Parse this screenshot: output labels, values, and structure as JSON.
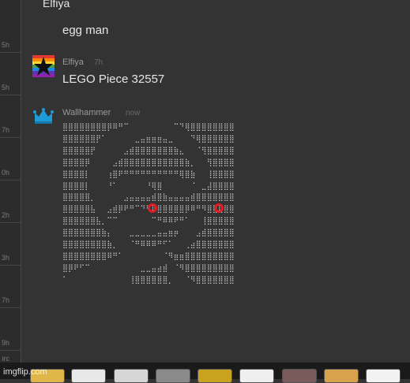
{
  "left_column": {
    "times": [
      "5h",
      "5h",
      "7h",
      "0h",
      "2h",
      "3h",
      "7h",
      "9h"
    ],
    "last_partial": "irc"
  },
  "messages": [
    {
      "name": "Elfiya",
      "text": "egg man"
    },
    {
      "name": "Elfiya",
      "time": "7h",
      "text": "LEGO Piece 32557",
      "avatar_icon": "rainbow-star-icon"
    },
    {
      "name": "Wallhammer",
      "time": "now",
      "avatar_icon": "crown-icon"
    }
  ],
  "ascii_art": [
    "⣿⣿⣿⣿⣿⣿⣿⣿⡿⠿⠛⠉⠀⠀⠀⠀⠀⠀⠀⠀⠉⠙⢿⣿⣿⣿⣿⣿⣿⣿⣿",
    "⣿⣿⣿⣿⣿⣿⡟⠁⠀⠀⠀⠀⠀⣀⣤⣶⣶⣶⣤⣀⠀⠀⠀⠙⢿⣿⣿⣿⣿⣿⣿",
    "⣿⣿⣿⣿⣿⡟⠀⠀⠀⠀⠀⣠⣾⣿⣿⣿⣿⣿⣿⣿⣷⣄⠀⠀⠈⢻⣿⣿⣿⣿⣿",
    "⣿⣿⣿⣿⡿⠀⠀⠀⠀⣠⣾⣿⣿⣿⣿⣿⣿⣿⣿⣿⣿⣿⣷⡀⠀⠀⢻⣿⣿⣿⣿",
    "⣿⣿⣿⣿⡇⠀⠀⠀⢰⣿⠟⠛⠛⠛⠛⠛⠛⠛⠛⠛⠛⢿⣿⣷⠀⠀⢸⣿⣿⣿⣿",
    "⣿⣿⣿⣿⡇⠀⠀⠀⠘⠁⠀⠀⠀⠀⠀⠘⢿⣿⠀⠀⠀⠀⠀⠈⠀⣀⣼⣿⣿⣿⣿",
    "⣿⣿⣿⣿⣿⡀⠀⠀⠀⠀⠀⣠⣤⣤⣤⣤⣾⣿⣷⣤⣤⣤⣤⣾⣿⣿⣿⣿⣿⣿⣿",
    "⣿⣿⣿⣿⣿⣧⠀⠀⣠⣾⡿⠟⠛⠉⠙⠛⠿⣿⣿⣿⣿⣿⡿⠿⠛⠻⣿⣿⣿⣿⣿",
    "⣿⣿⣿⣿⣿⣿⣧⡀⠉⠉⠀⠀⠀⠀⠀⠀⠉⠛⠿⠿⠟⠛⠁⠀⠀⢸⣿⣿⣿⣿⣿",
    "⣿⣿⣿⣿⣿⣿⣿⣷⡄⠀⠀⠀⣀⣀⣀⣀⣀⣤⣤⣶⡶⠀⠀⠀⣠⣾⣿⣿⣿⣿⣿",
    "⣿⣿⣿⣿⣿⣿⣿⣿⣷⡀⠀⠀⠈⠛⠿⠿⠿⠛⠋⠁⠀⠀⢀⣴⣿⣿⣿⣿⣿⣿⣿",
    "⣿⣿⣿⣿⣿⣿⣿⣿⠿⠛⠁⠀⠀⠀⠀⠀⠀⠀⠈⠻⣶⣶⣿⣿⣿⣿⣿⣿⣿⣿⣿",
    "⣿⡿⠟⠋⠉⠀⠀⠀⠀⠀⠀⠀⠀⠀⣀⣀⣤⣴⣾⠀⠈⠻⣿⣿⣿⣿⣿⣿⣿⣿⣿",
    "⠁⠀⠀⠀⠀⠀⠀⠀⠀⠀⠀⠀⢸⣿⣿⣿⣿⣿⣿⡀⠀⠀⠈⠻⣿⣿⣿⣿⣿⣿⣿"
  ],
  "bottom": {
    "watermark": "imgflip.com"
  },
  "colors": {
    "background": "#333333",
    "eye": "#e31b23"
  }
}
